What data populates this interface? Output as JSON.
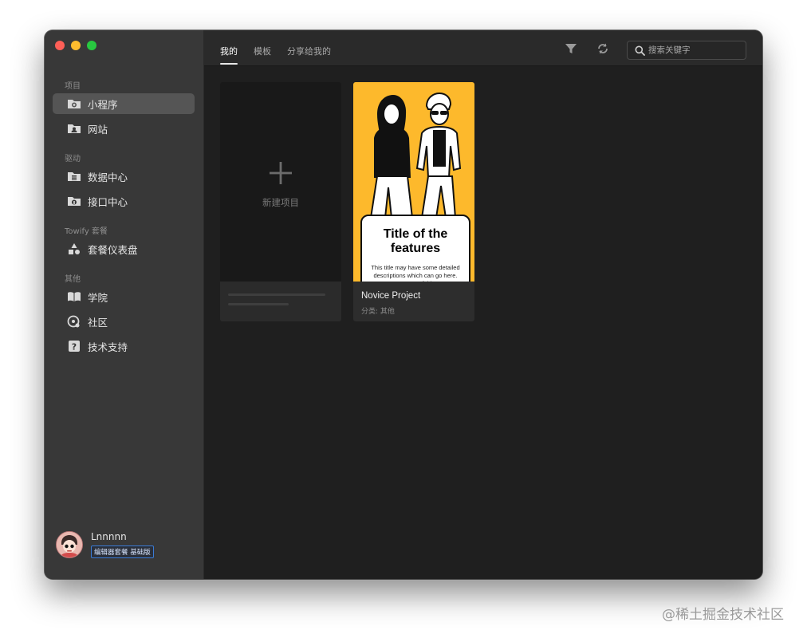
{
  "window": {
    "traffic_lights": [
      "close",
      "minimize",
      "zoom"
    ]
  },
  "sidebar": {
    "sections": [
      {
        "title": "项目",
        "items": [
          {
            "label": "小程序",
            "icon": "mini-program-folder-icon",
            "active": true
          },
          {
            "label": "网站",
            "icon": "website-folder-icon"
          }
        ]
      },
      {
        "title": "驱动",
        "items": [
          {
            "label": "数据中心",
            "icon": "database-folder-icon"
          },
          {
            "label": "接口中心",
            "icon": "api-folder-icon"
          }
        ]
      },
      {
        "title": "Towify 套餐",
        "items": [
          {
            "label": "套餐仪表盘",
            "icon": "shapes-icon"
          }
        ]
      },
      {
        "title": "其他",
        "items": [
          {
            "label": "学院",
            "icon": "book-icon"
          },
          {
            "label": "社区",
            "icon": "community-icon"
          },
          {
            "label": "技术支持",
            "icon": "help-icon"
          }
        ]
      }
    ],
    "profile": {
      "username": "Lnnnnn",
      "plan": "编辑器套餐 基础版"
    }
  },
  "header": {
    "tabs": [
      {
        "label": "我的",
        "active": true
      },
      {
        "label": "模板"
      },
      {
        "label": "分享给我的"
      }
    ],
    "search": {
      "placeholder": "搜索关键字"
    }
  },
  "cards": {
    "new_project": {
      "label": "新建项目"
    },
    "projects": [
      {
        "name": "Novice Project",
        "category": "分类: 其他",
        "cover": {
          "title": "Title of the features",
          "description": "This title may have some detailed descriptions which can go here. But part of this",
          "background": "#fdb92c"
        }
      }
    ]
  },
  "watermark": "@稀土掘金技术社区"
}
